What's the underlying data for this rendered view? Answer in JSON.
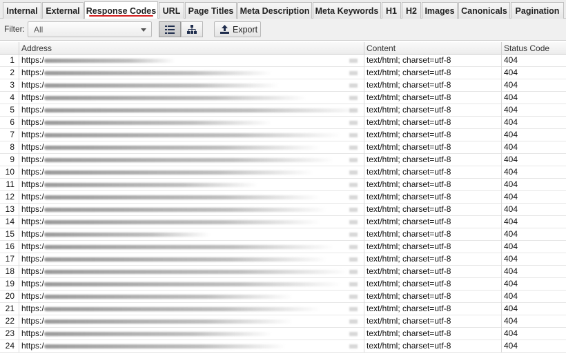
{
  "tabs": [
    {
      "label": "Internal",
      "active": false
    },
    {
      "label": "External",
      "active": false
    },
    {
      "label": "Response Codes",
      "active": true
    },
    {
      "label": "URL",
      "active": false
    },
    {
      "label": "Page Titles",
      "active": false
    },
    {
      "label": "Meta Description",
      "active": false
    },
    {
      "label": "Meta Keywords",
      "active": false
    },
    {
      "label": "H1",
      "active": false
    },
    {
      "label": "H2",
      "active": false
    },
    {
      "label": "Images",
      "active": false
    },
    {
      "label": "Canonicals",
      "active": false
    },
    {
      "label": "Pagination",
      "active": false
    }
  ],
  "toolbar": {
    "filter_label": "Filter:",
    "filter_value": "All",
    "list_view_icon": "list-icon",
    "tree_view_icon": "tree-icon",
    "export_label": "Export",
    "export_icon": "upload-icon"
  },
  "table": {
    "columns": [
      "",
      "Address",
      "Content",
      "Status Code"
    ],
    "rows": [
      {
        "num": "1",
        "address": "https:/",
        "content": "text/html; charset=utf-8",
        "status": "404"
      },
      {
        "num": "2",
        "address": "https:/",
        "content": "text/html; charset=utf-8",
        "status": "404"
      },
      {
        "num": "3",
        "address": "https:/",
        "content": "text/html; charset=utf-8",
        "status": "404"
      },
      {
        "num": "4",
        "address": "https:/",
        "content": "text/html; charset=utf-8",
        "status": "404"
      },
      {
        "num": "5",
        "address": "https:/",
        "content": "text/html; charset=utf-8",
        "status": "404"
      },
      {
        "num": "6",
        "address": "https:/",
        "content": "text/html; charset=utf-8",
        "status": "404"
      },
      {
        "num": "7",
        "address": "https:/",
        "content": "text/html; charset=utf-8",
        "status": "404"
      },
      {
        "num": "8",
        "address": "https:/",
        "content": "text/html; charset=utf-8",
        "status": "404"
      },
      {
        "num": "9",
        "address": "https:/",
        "content": "text/html; charset=utf-8",
        "status": "404"
      },
      {
        "num": "10",
        "address": "https:/",
        "content": "text/html; charset=utf-8",
        "status": "404"
      },
      {
        "num": "11",
        "address": "https:/",
        "content": "text/html; charset=utf-8",
        "status": "404"
      },
      {
        "num": "12",
        "address": "https:/",
        "content": "text/html; charset=utf-8",
        "status": "404"
      },
      {
        "num": "13",
        "address": "https:/",
        "content": "text/html; charset=utf-8",
        "status": "404"
      },
      {
        "num": "14",
        "address": "https:/",
        "content": "text/html; charset=utf-8",
        "status": "404"
      },
      {
        "num": "15",
        "address": "https:/",
        "content": "text/html; charset=utf-8",
        "status": "404"
      },
      {
        "num": "16",
        "address": "https:/",
        "content": "text/html; charset=utf-8",
        "status": "404"
      },
      {
        "num": "17",
        "address": "https:/",
        "content": "text/html; charset=utf-8",
        "status": "404"
      },
      {
        "num": "18",
        "address": "https:/",
        "content": "text/html; charset=utf-8",
        "status": "404"
      },
      {
        "num": "19",
        "address": "https:/",
        "content": "text/html; charset=utf-8",
        "status": "404"
      },
      {
        "num": "20",
        "address": "https:/",
        "content": "text/html; charset=utf-8",
        "status": "404"
      },
      {
        "num": "21",
        "address": "https:/",
        "content": "text/html; charset=utf-8",
        "status": "404"
      },
      {
        "num": "22",
        "address": "https:/",
        "content": "text/html; charset=utf-8",
        "status": "404"
      },
      {
        "num": "23",
        "address": "https:/",
        "content": "text/html; charset=utf-8",
        "status": "404"
      },
      {
        "num": "24",
        "address": "https:/",
        "content": "text/html; charset=utf-8",
        "status": "404"
      }
    ]
  },
  "colors": {
    "active_tab_underline": "#d41f1f",
    "header_bg": "#ededed",
    "toolbar_bg": "#f0f0f0"
  }
}
